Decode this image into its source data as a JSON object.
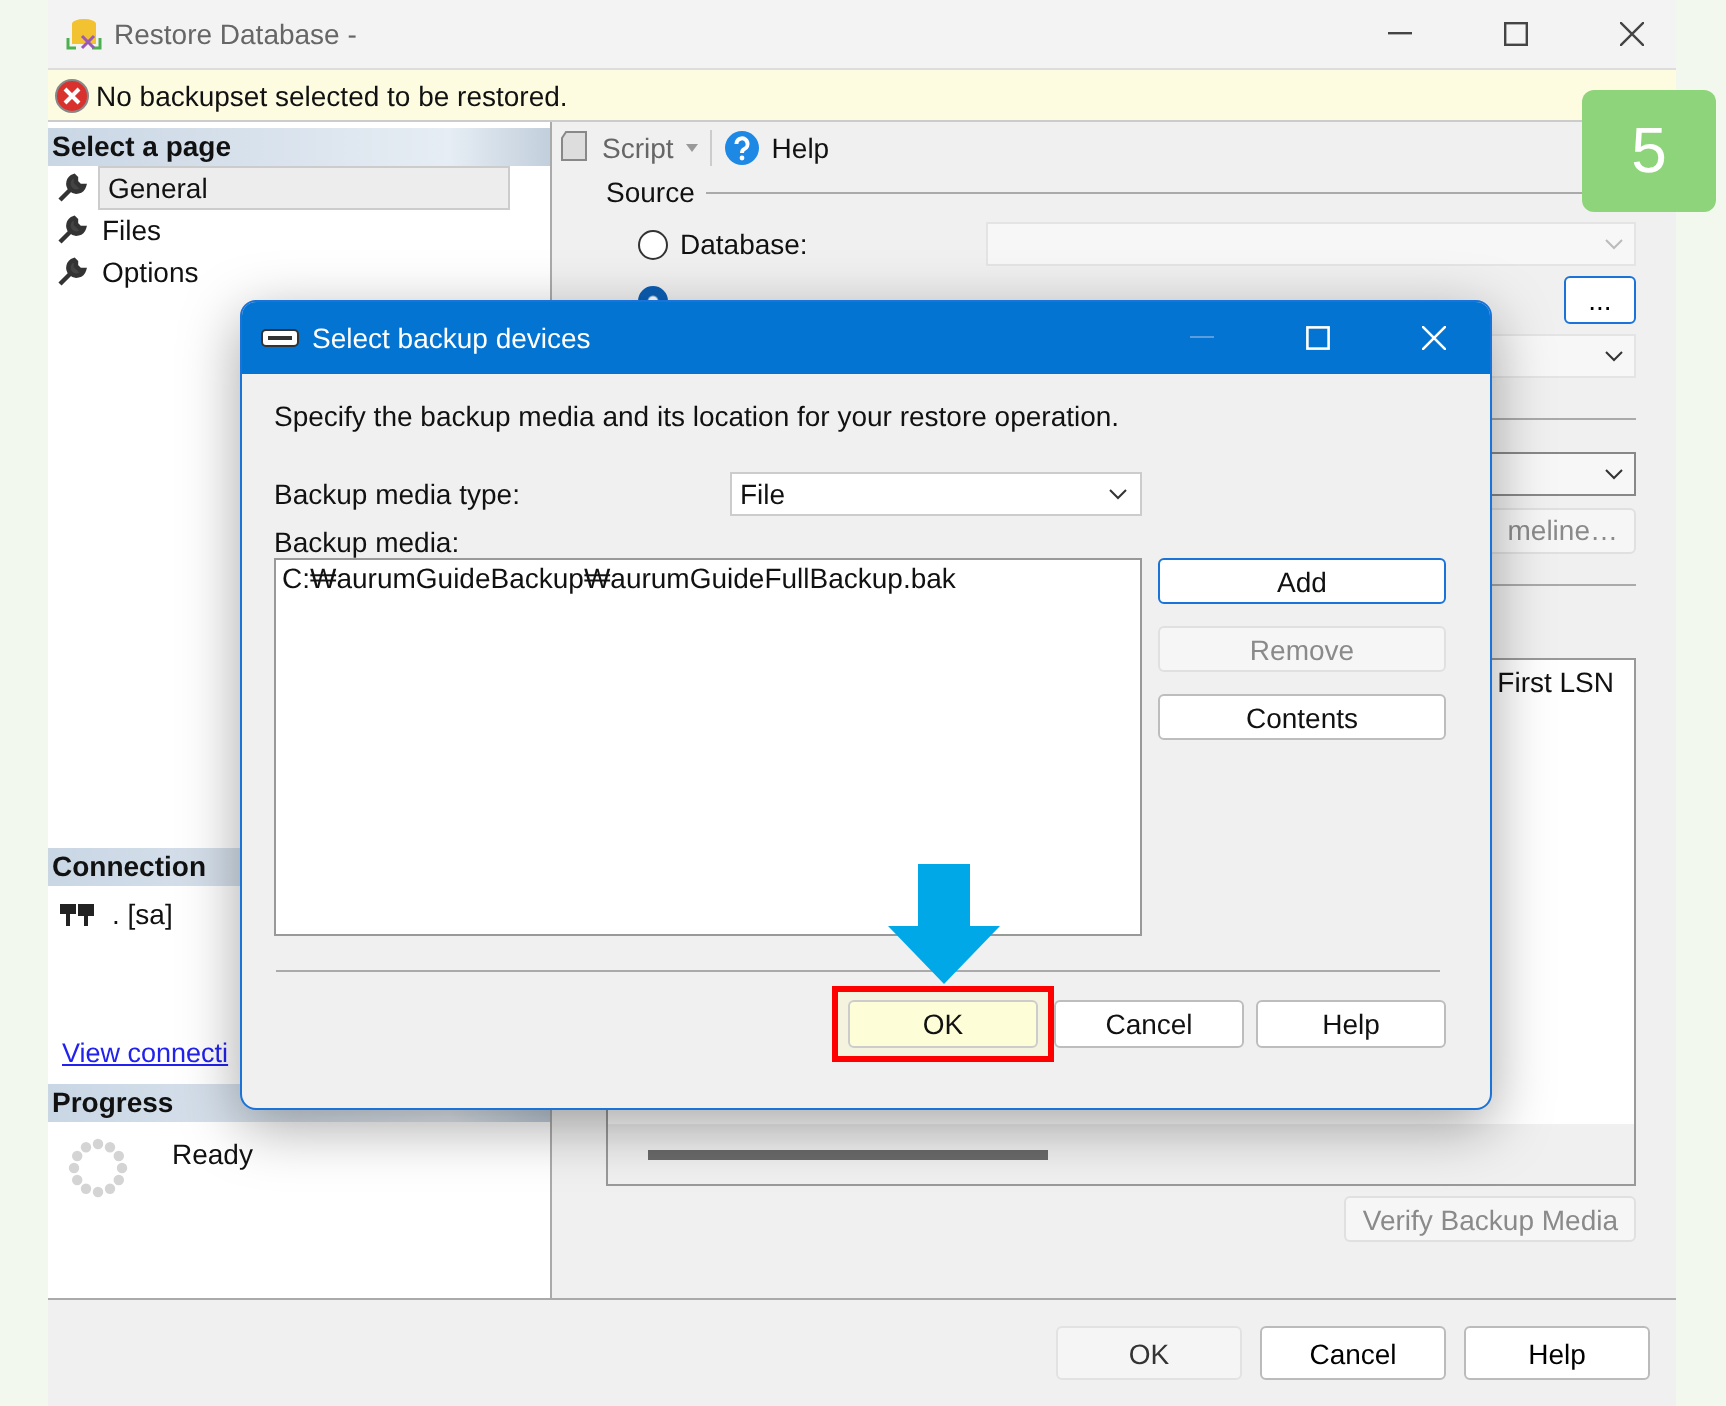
{
  "window": {
    "title": "Restore Database -"
  },
  "error_bar": {
    "message": "No backupset selected to be restored."
  },
  "sidebar": {
    "heading": "Select a page",
    "items": [
      {
        "label": "General",
        "selected": true
      },
      {
        "label": "Files",
        "selected": false
      },
      {
        "label": "Options",
        "selected": false
      }
    ]
  },
  "connection": {
    "heading": "Connection",
    "server": ". [sa]",
    "link": "View connecti"
  },
  "progress": {
    "heading": "Progress",
    "status": "Ready"
  },
  "toolbar": {
    "script": "Script",
    "help": "Help"
  },
  "source": {
    "heading": "Source",
    "options": [
      {
        "label": "Database:",
        "selected": false
      },
      {
        "selected": true
      }
    ],
    "browse": "...",
    "timeline": "meline…"
  },
  "backup_grid": {
    "columns": [
      "First LSN"
    ]
  },
  "verify_button": {
    "label": "Verify Backup Media",
    "disabled": true
  },
  "footer_buttons": [
    {
      "label": "OK",
      "disabled": true
    },
    {
      "label": "Cancel",
      "disabled": false
    },
    {
      "label": "Help",
      "disabled": false
    }
  ],
  "step_badge": "5",
  "dialog": {
    "title": "Select backup devices",
    "instruction": "Specify the backup media and its location for your restore operation.",
    "media_type_label": "Backup media type:",
    "media_type": "File",
    "media_label": "Backup media:",
    "media": [
      "C:₩aurumGuideBackup₩aurumGuideFullBackup.bak"
    ],
    "side_buttons": [
      {
        "label": "Add",
        "disabled": false
      },
      {
        "label": "Remove",
        "disabled": true
      },
      {
        "label": "Contents",
        "disabled": false
      }
    ],
    "buttons": [
      {
        "label": "OK",
        "highlighted": true
      },
      {
        "label": "Cancel",
        "highlighted": false
      },
      {
        "label": "Help",
        "highlighted": false
      }
    ]
  }
}
